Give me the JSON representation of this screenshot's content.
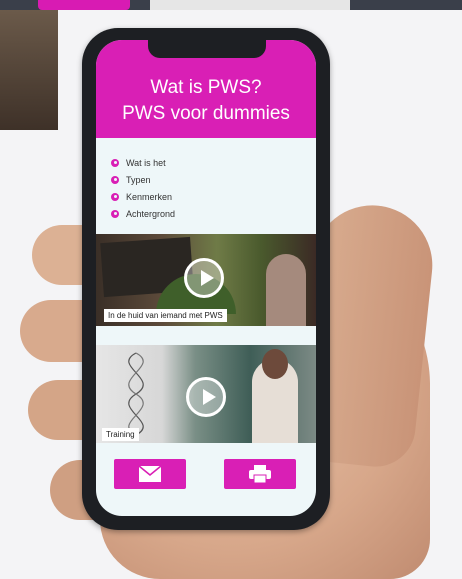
{
  "app": {
    "title_line1": "Wat is PWS?",
    "title_line2": "PWS voor dummies"
  },
  "menu": {
    "items": [
      {
        "label": "Wat is het"
      },
      {
        "label": "Typen"
      },
      {
        "label": "Kenmerken"
      },
      {
        "label": "Achtergrond"
      }
    ]
  },
  "videos": [
    {
      "caption": "In de huid van iemand met PWS",
      "icon": "play-icon"
    },
    {
      "caption": "Training",
      "icon": "play-icon"
    }
  ],
  "footer": {
    "mail_icon": "mail-icon",
    "print_icon": "print-icon"
  },
  "colors": {
    "accent": "#d91fb5",
    "screen_background": "#eef7f9"
  }
}
